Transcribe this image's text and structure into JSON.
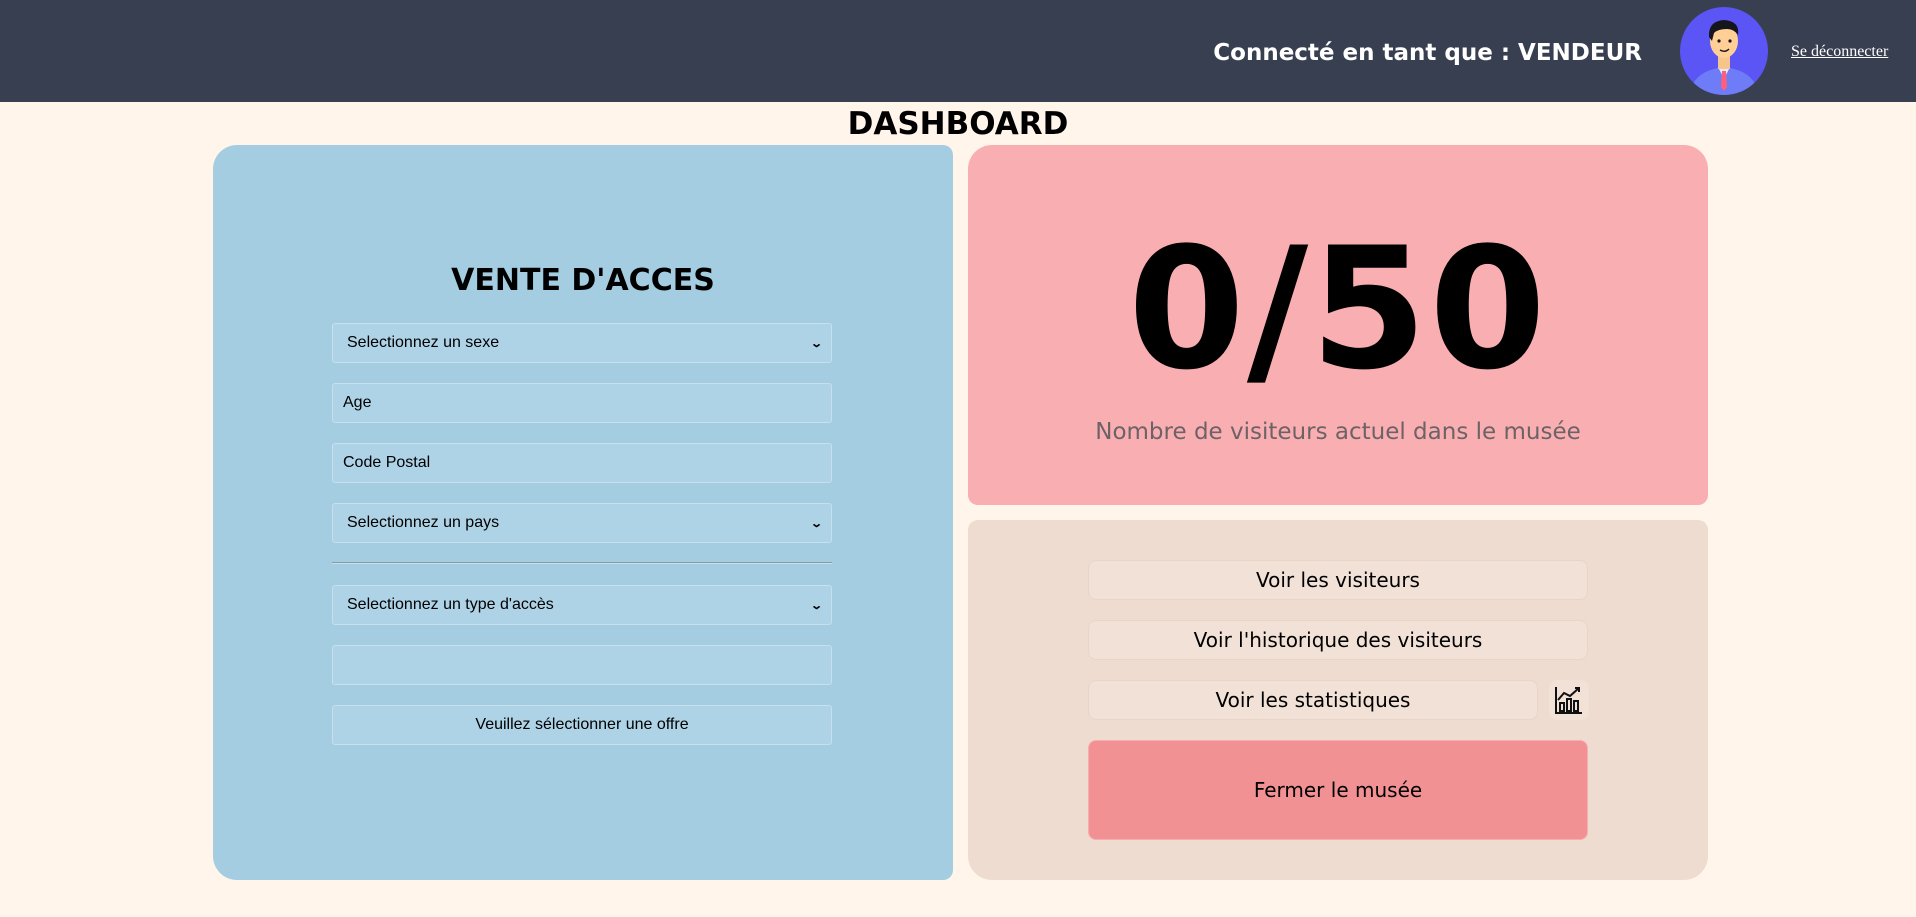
{
  "header": {
    "user_label": "Connecté en tant que : VENDEUR",
    "logout_label": "Se déconnecter",
    "avatar_icon": "user-avatar-icon",
    "colors": {
      "bar": "#373f51",
      "avatar_bg": "#5b55f5"
    }
  },
  "page": {
    "title": "DASHBOARD",
    "background": "#fff5ea"
  },
  "sale": {
    "title": "VENTE D'ACCES",
    "sex_select": "Selectionnez un sexe",
    "age_placeholder": "Age",
    "postal_placeholder": "Code Postal",
    "country_select": "Selectionnez un pays",
    "access_type_select": "Selectionnez un type d'accès",
    "price_value": "",
    "submit_label": "Veuillez sélectionner une offre",
    "color": "#a4cde1"
  },
  "counter": {
    "value": "0/50",
    "caption": "Nombre de visiteurs actuel dans le musée",
    "color": "#f9aeb2"
  },
  "actions": {
    "view_visitors": "Voir les visiteurs",
    "view_history": "Voir l'historique des visiteurs",
    "view_stats": "Voir les statistiques",
    "stats_icon": "chart-icon",
    "close_museum": "Fermer le musée",
    "color": "#efdcd1",
    "close_color": "#f29193"
  }
}
